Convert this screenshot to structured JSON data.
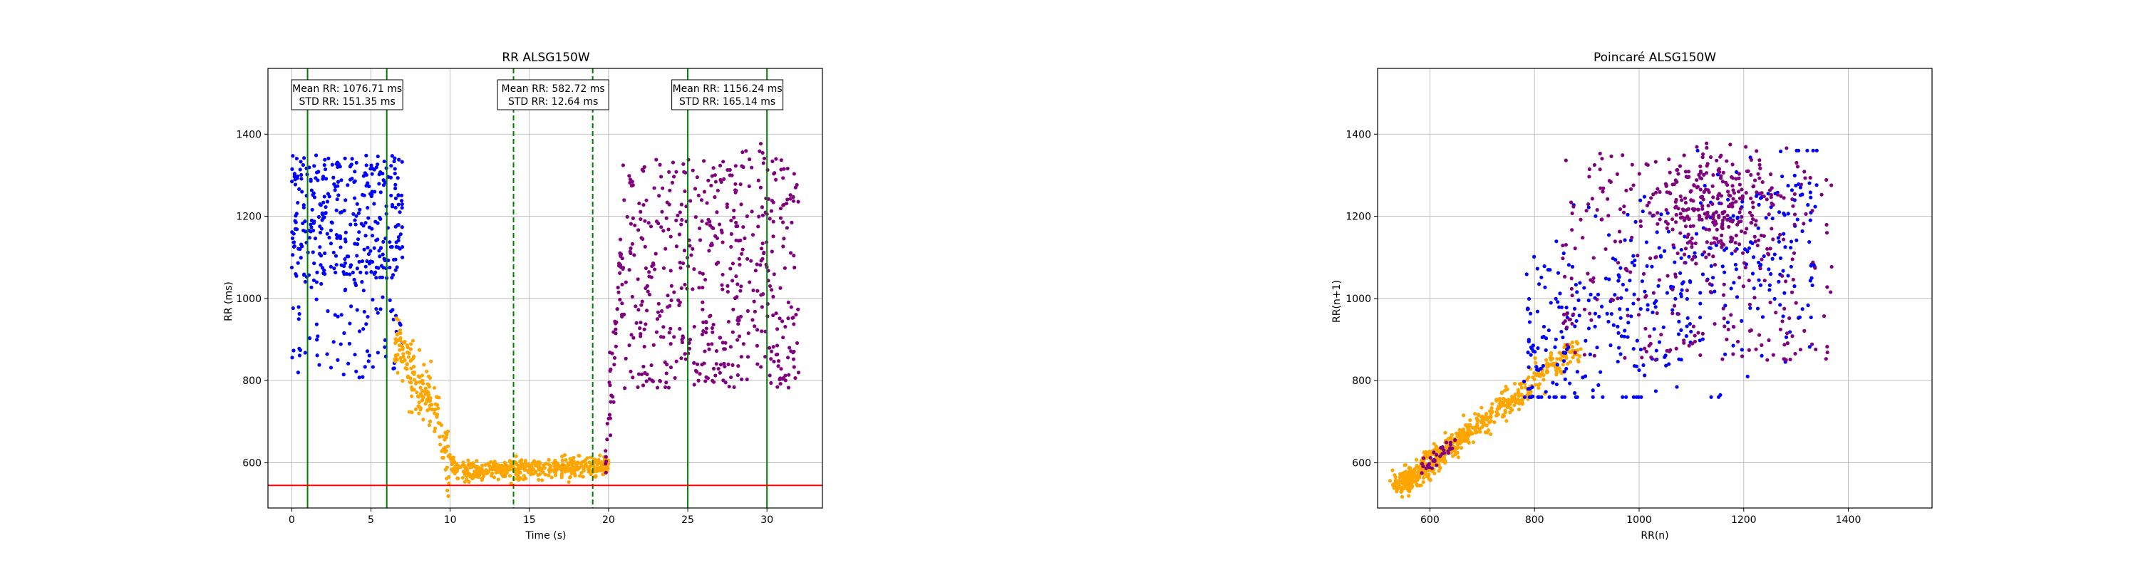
{
  "chart_data": [
    {
      "type": "scatter",
      "title": "RR ALSG150W",
      "xlabel": "Time (s)",
      "ylabel": "RR (ms)",
      "xlim": [
        -1.5,
        33.5
      ],
      "ylim": [
        490,
        1560
      ],
      "xticks": [
        0,
        5,
        10,
        15,
        20,
        25,
        30
      ],
      "yticks": [
        600,
        800,
        1000,
        1200,
        1400
      ],
      "grid": true,
      "threshold_line": {
        "y": 545,
        "color": "#ff0000"
      },
      "window_lines": [
        {
          "x": 1,
          "style": "solid",
          "color": "#008000"
        },
        {
          "x": 6,
          "style": "solid",
          "color": "#008000"
        },
        {
          "x": 14,
          "style": "dashed",
          "color": "#008000"
        },
        {
          "x": 19,
          "style": "dashed",
          "color": "#008000"
        },
        {
          "x": 25,
          "style": "solid",
          "color": "#008000"
        },
        {
          "x": 30,
          "style": "solid",
          "color": "#008000"
        }
      ],
      "annotations": [
        {
          "x": 3.5,
          "mean": "Mean RR: 1076.71 ms",
          "std": "STD RR: 151.35 ms"
        },
        {
          "x": 16.5,
          "mean": "Mean RR: 582.72 ms",
          "std": "STD RR: 12.64 ms"
        },
        {
          "x": 27.5,
          "mean": "Mean RR: 1156.24 ms",
          "std": "STD RR: 165.14 ms"
        }
      ],
      "series": [
        {
          "color": "#0000ff",
          "x_range": [
            0,
            7
          ],
          "y_center": 1076,
          "y_spread": 151,
          "n": 420
        },
        {
          "color": "#ffa500",
          "x_range": [
            6.5,
            20
          ],
          "profile": [
            [
              6.5,
              900
            ],
            [
              7.2,
              860
            ],
            [
              8,
              770
            ],
            [
              8.8,
              760
            ],
            [
              9.3,
              700
            ],
            [
              9.8,
              610
            ],
            [
              10.5,
              580
            ],
            [
              20,
              590
            ]
          ],
          "y_spread": 12,
          "n": 640
        },
        {
          "color": "#800080",
          "x_range": [
            19.8,
            32
          ],
          "y_center": 1156,
          "y_spread": 165,
          "n": 560
        }
      ]
    },
    {
      "type": "scatter",
      "title": "Poincaré ALSG150W",
      "xlabel": "RR(n)",
      "ylabel": "RR(n+1)",
      "xlim": [
        500,
        1560
      ],
      "ylim": [
        490,
        1560
      ],
      "xticks": [
        600,
        800,
        1000,
        1200,
        1400
      ],
      "yticks": [
        600,
        800,
        1000,
        1200,
        1400
      ],
      "grid": true,
      "series": [
        {
          "color": "#0000ff",
          "center": [
            1076,
            1076
          ],
          "spread": 151,
          "n": 420
        },
        {
          "color": "#ffa500",
          "center": [
            620,
            620
          ],
          "spread": 60,
          "n": 640
        },
        {
          "color": "#800080",
          "center": [
            1156,
            1156
          ],
          "spread": 165,
          "n": 560
        }
      ]
    }
  ]
}
